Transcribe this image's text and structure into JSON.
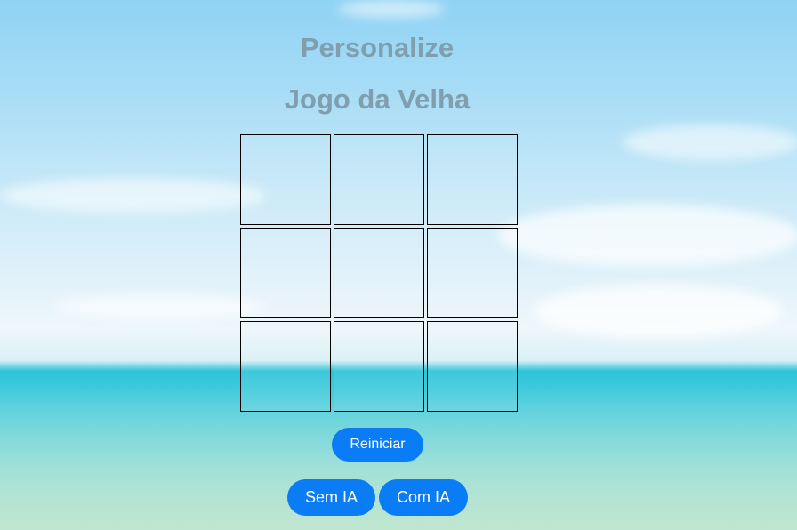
{
  "header": {
    "title_line1": "Personalize",
    "title_line2": "Jogo da Velha"
  },
  "board": {
    "cells": [
      "",
      "",
      "",
      "",
      "",
      "",
      "",
      "",
      ""
    ]
  },
  "controls": {
    "restart_label": "Reiniciar",
    "no_ai_label": "Sem IA",
    "with_ai_label": "Com IA"
  },
  "colors": {
    "title": "#7f9fae",
    "button": "#0a7cf5",
    "button_text": "#ffffff",
    "cell_border": "#000000"
  }
}
